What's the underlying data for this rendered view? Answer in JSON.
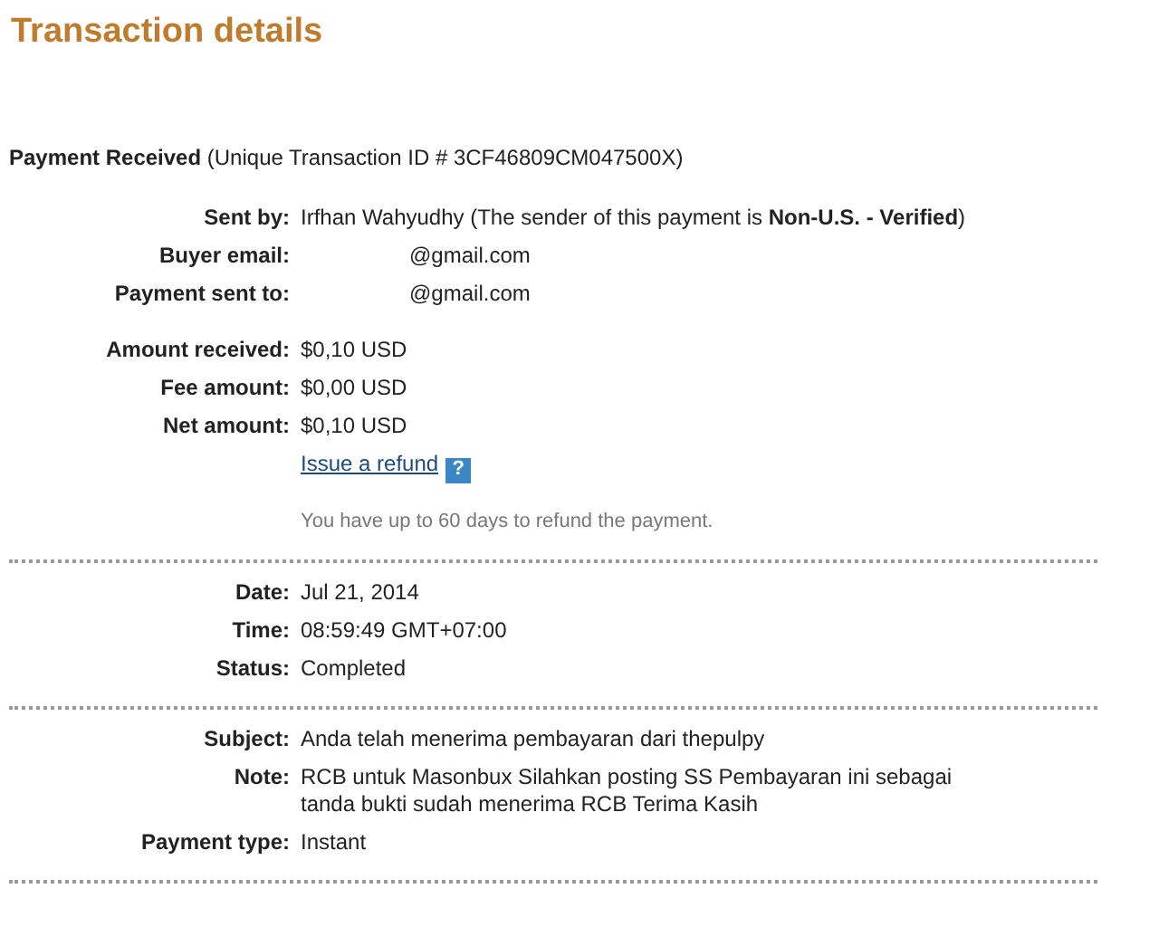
{
  "title": "Transaction details",
  "summary": {
    "label": "Payment Received",
    "detail": "(Unique Transaction ID # 3CF46809CM047500X)"
  },
  "sections": [
    {
      "groups": [
        [
          {
            "kind": "field",
            "label": "Sent by:",
            "value": "Irfhan Wahyudhy (The sender of this payment is **Non-U.S. - Verified**)"
          },
          {
            "kind": "masked",
            "label": "Buyer email:",
            "value": "@gmail.com"
          },
          {
            "kind": "masked",
            "label": "Payment sent to:",
            "value": "@gmail.com"
          }
        ],
        [
          {
            "kind": "field",
            "label": "Amount received:",
            "value": "$0,10 USD"
          },
          {
            "kind": "field",
            "label": "Fee amount:",
            "value": "$0,00 USD"
          },
          {
            "kind": "field",
            "label": "Net amount:",
            "value": "$0,10 USD"
          },
          {
            "kind": "link",
            "value": "Issue a refund",
            "help": "?"
          },
          {
            "kind": "hint",
            "value": "You have up to 60 days to refund the payment."
          }
        ]
      ]
    },
    {
      "groups": [
        [
          {
            "kind": "field",
            "label": "Date:",
            "value": "Jul 21, 2014"
          },
          {
            "kind": "field",
            "label": "Time:",
            "value": "08:59:49 GMT+07:00"
          },
          {
            "kind": "field",
            "label": "Status:",
            "value": "Completed"
          }
        ]
      ]
    },
    {
      "groups": [
        [
          {
            "kind": "field",
            "label": "Subject:",
            "value": "Anda telah menerima pembayaran dari thepulpy"
          },
          {
            "kind": "field",
            "label": "Note:",
            "value": "RCB untuk Masonbux Silahkan posting SS Pembayaran ini sebagai tanda bukti sudah menerima RCB Terima Kasih"
          },
          {
            "kind": "field",
            "label": "Payment type:",
            "value": "Instant"
          }
        ]
      ]
    }
  ]
}
